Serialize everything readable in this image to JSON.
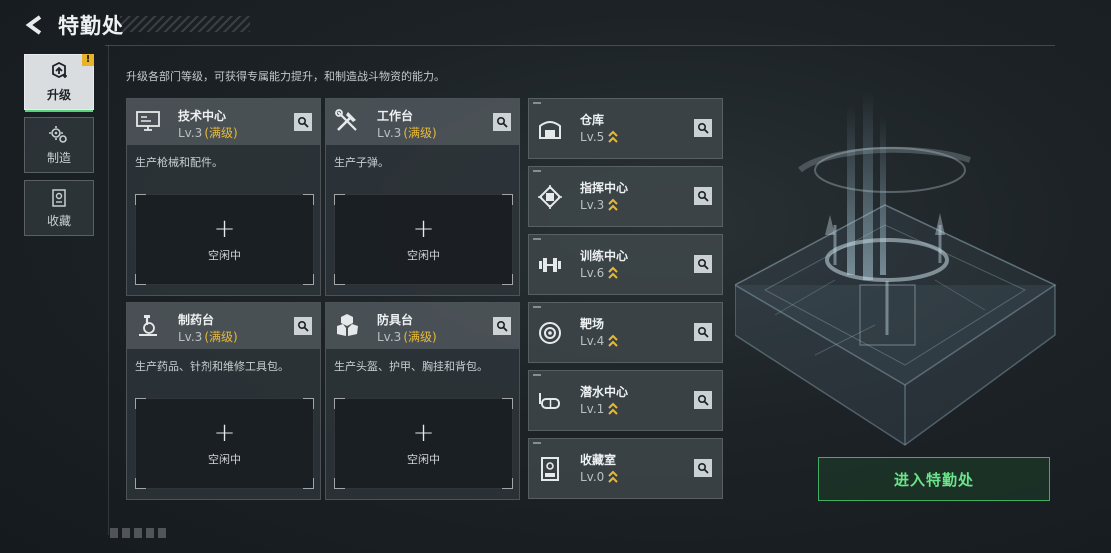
{
  "header": {
    "title": "特勤处"
  },
  "nav": [
    {
      "label": "升级",
      "icon": "upgrade-icon",
      "active": true,
      "badge": "!"
    },
    {
      "label": "制造",
      "icon": "gears-icon",
      "active": false
    },
    {
      "label": "收藏",
      "icon": "collection-icon",
      "active": false
    }
  ],
  "description": "升级各部门等级，可获得专属能力提升，和制造战斗物资的能力。",
  "departments": [
    {
      "name": "技术中心",
      "level": "Lv.3",
      "status": "(满级)",
      "desc": "生产枪械和配件。",
      "slot_label": "空闲中",
      "icon": "monitor-icon"
    },
    {
      "name": "工作台",
      "level": "Lv.3",
      "status": "(满级)",
      "desc": "生产子弹。",
      "slot_label": "空闲中",
      "icon": "tools-icon"
    },
    {
      "name": "制药台",
      "level": "Lv.3",
      "status": "(满级)",
      "desc": "生产药品、针剂和维修工具包。",
      "slot_label": "空闲中",
      "icon": "microscope-icon"
    },
    {
      "name": "防具台",
      "level": "Lv.3",
      "status": "(满级)",
      "desc": "生产头盔、护甲、胸挂和背包。",
      "slot_label": "空闲中",
      "icon": "armor-icon"
    }
  ],
  "facilities": [
    {
      "name": "仓库",
      "level": "Lv.5",
      "icon": "warehouse-icon"
    },
    {
      "name": "指挥中心",
      "level": "Lv.3",
      "icon": "chip-icon"
    },
    {
      "name": "训练中心",
      "level": "Lv.6",
      "icon": "dumbbell-icon"
    },
    {
      "name": "靶场",
      "level": "Lv.4",
      "icon": "target-icon"
    },
    {
      "name": "潜水中心",
      "level": "Lv.1",
      "icon": "diving-mask-icon"
    },
    {
      "name": "收藏室",
      "level": "Lv.0",
      "icon": "display-case-icon"
    }
  ],
  "enter_button": "进入特勤处",
  "colors": {
    "accent_green": "#57d27a",
    "max_level": "#e6b93a",
    "upgrade_chevron": "#e6b93a"
  }
}
